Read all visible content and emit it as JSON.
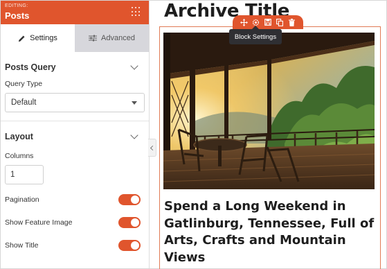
{
  "sidebar": {
    "header": {
      "editing_label": "EDITING:",
      "title": "Posts",
      "menu_icon": "grid-dots-icon"
    },
    "tabs": [
      {
        "label": "Settings",
        "icon": "pencil-icon",
        "active": true
      },
      {
        "label": "Advanced",
        "icon": "sliders-icon",
        "active": false
      }
    ],
    "posts_query": {
      "heading": "Posts Query",
      "query_type_label": "Query Type",
      "query_type_value": "Default"
    },
    "layout": {
      "heading": "Layout",
      "columns_label": "Columns",
      "columns_value": "1",
      "toggles": [
        {
          "label": "Pagination",
          "on": true
        },
        {
          "label": "Show Feature Image",
          "on": true
        },
        {
          "label": "Show Title",
          "on": true
        }
      ]
    }
  },
  "canvas": {
    "archive_title": "Archive Title",
    "toolbar_icons": [
      "move-icon",
      "gear-icon",
      "save-icon",
      "duplicate-icon",
      "trash-icon"
    ],
    "tooltip": "Block Settings",
    "post_title": "Spend a Long Weekend in Gatlinburg, Tennessee, Full of Arts, Crafts and Mountain Views"
  },
  "colors": {
    "accent": "#e0552d",
    "inactive_tab": "#d7d7dc",
    "tooltip_bg": "#2f2f33"
  }
}
